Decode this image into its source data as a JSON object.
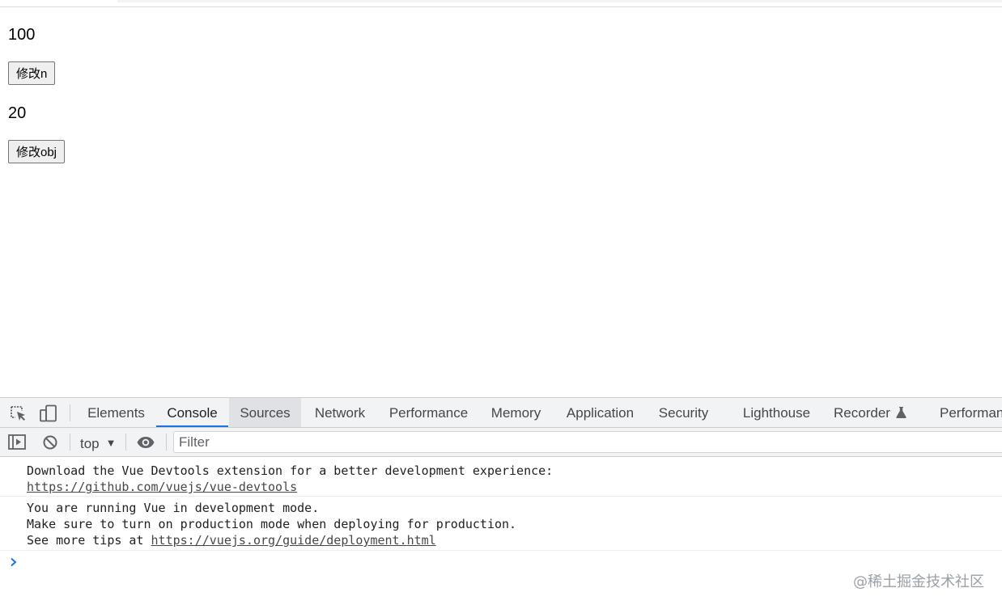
{
  "page": {
    "n_value": "100",
    "edit_n_label": "修改n",
    "obj_value": "20",
    "edit_obj_label": "修改obj"
  },
  "devtools": {
    "tabs": [
      {
        "label": "Elements"
      },
      {
        "label": "Console"
      },
      {
        "label": "Sources"
      },
      {
        "label": "Network"
      },
      {
        "label": "Performance"
      },
      {
        "label": "Memory"
      },
      {
        "label": "Application"
      },
      {
        "label": "Security"
      },
      {
        "label": "Lighthouse"
      },
      {
        "label": "Recorder"
      },
      {
        "label": "Performan"
      }
    ],
    "active_tab": "Console",
    "hovered_tab": "Sources",
    "accent_color": "#1a73e8",
    "toolbar": {
      "context": "top",
      "filter_placeholder": "Filter"
    },
    "console": {
      "messages": [
        {
          "lines": [
            {
              "text": "Download the Vue Devtools extension for a better development experience:"
            },
            {
              "link": "https://github.com/vuejs/vue-devtools"
            }
          ]
        },
        {
          "lines": [
            {
              "text": "You are running Vue in development mode."
            },
            {
              "text": "Make sure to turn on production mode when deploying for production."
            },
            {
              "prefix": "See more tips at ",
              "link": "https://vuejs.org/guide/deployment.html"
            }
          ]
        }
      ]
    }
  },
  "watermark": "@稀土掘金技术社区"
}
